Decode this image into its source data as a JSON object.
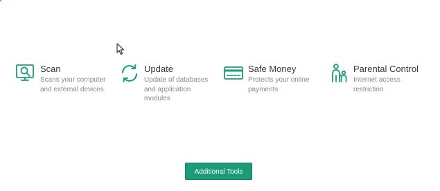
{
  "accent_color": "#1c9b79",
  "features": [
    {
      "icon": "scan-monitor-icon",
      "title": "Scan",
      "desc_line1": "Scans your computer",
      "desc_line2": "and external devices"
    },
    {
      "icon": "update-arrows-icon",
      "title": "Update",
      "desc_line1": "Update of databases",
      "desc_line2": "and application",
      "desc_line3": "modules"
    },
    {
      "icon": "credit-card-icon",
      "title": "Safe Money",
      "desc_line1": "Protects your online",
      "desc_line2": "payments"
    },
    {
      "icon": "parent-child-icon",
      "title": "Parental Control",
      "desc_line1": "Internet access",
      "desc_line2": "restriction"
    }
  ],
  "footer": {
    "tools_button_label": "Additional Tools"
  }
}
